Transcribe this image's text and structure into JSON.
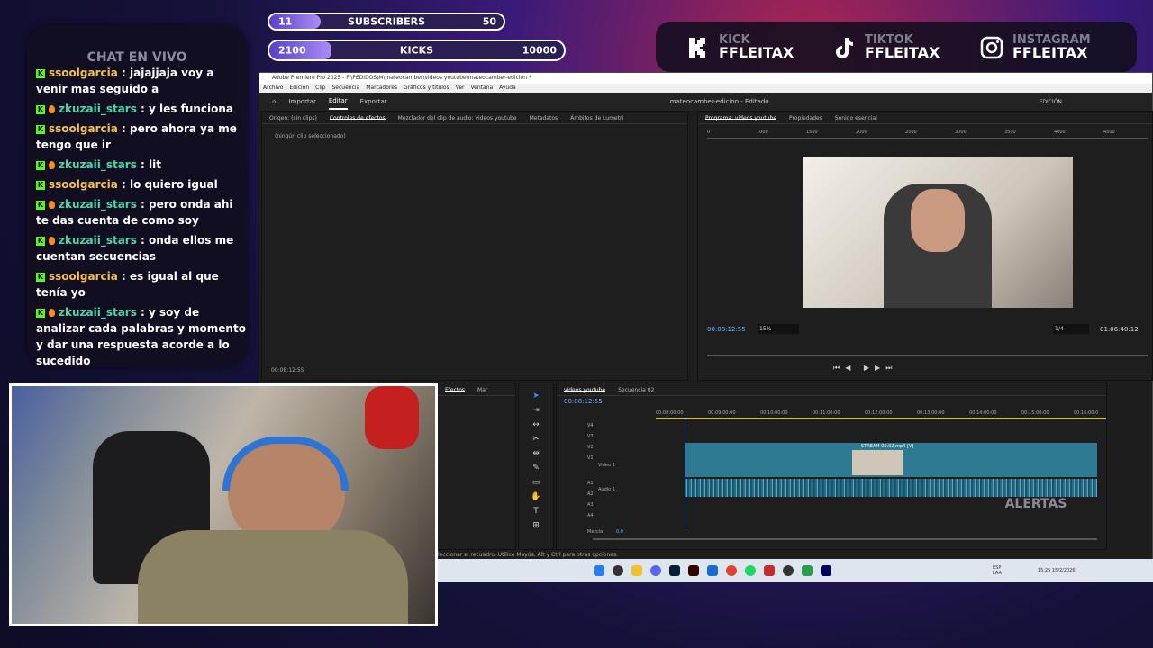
{
  "goals": [
    {
      "current": "11",
      "label": "SUBSCRIBERS",
      "goal": "50",
      "progress": 0.22
    },
    {
      "current": "2100",
      "label": "KICKS",
      "goal": "10000",
      "progress": 0.21
    }
  ],
  "chat": {
    "title": "CHAT EN VIVO",
    "messages": [
      {
        "user": "ssoolgarcia",
        "text": ": jajajjaja voy a venir mas seguido a",
        "badges": [
          "kick"
        ],
        "color": "u1"
      },
      {
        "user": "zkuzaii_stars",
        "text": ": y les funciona",
        "badges": [
          "kick",
          "fire"
        ],
        "color": "u2"
      },
      {
        "user": "ssoolgarcia",
        "text": ": pero ahora ya me tengo que ir",
        "badges": [
          "kick"
        ],
        "color": "u1"
      },
      {
        "user": "zkuzaii_stars",
        "text": ": lit",
        "badges": [
          "kick",
          "fire"
        ],
        "color": "u2"
      },
      {
        "user": "ssoolgarcia",
        "text": ": lo quiero igual",
        "badges": [
          "kick"
        ],
        "color": "u1"
      },
      {
        "user": "zkuzaii_stars",
        "text": ": pero onda ahi te das cuenta de como soy",
        "badges": [
          "kick",
          "fire"
        ],
        "color": "u2"
      },
      {
        "user": "zkuzaii_stars",
        "text": ": onda ellos me cuentan secuencias",
        "badges": [
          "kick",
          "fire"
        ],
        "color": "u2"
      },
      {
        "user": "ssoolgarcia",
        "text": ": es igual al que tenía yo",
        "badges": [
          "kick"
        ],
        "color": "u1"
      },
      {
        "user": "zkuzaii_stars",
        "text": ": y soy de analizar cada palabras y momento y dar una respuesta acorde a lo sucedido",
        "badges": [
          "kick",
          "fire"
        ],
        "color": "u2"
      }
    ]
  },
  "socials": [
    {
      "platform": "KICK",
      "handle": "FFLEITAX",
      "icon": "kick-icon"
    },
    {
      "platform": "TIKTOK",
      "handle": "FFLEITAX",
      "icon": "tiktok-icon"
    },
    {
      "platform": "INSTAGRAM",
      "handle": "FFLEITAX",
      "icon": "instagram-icon"
    }
  ],
  "premiere": {
    "title": "Adobe Premiere Pro 2025 - F:\\PEDIDOS\\M\\mateocamber\\videos youtube\\mateocamber-edicion *",
    "menu": [
      "Archivo",
      "Edición",
      "Clip",
      "Secuencia",
      "Marcadores",
      "Gráficos y títulos",
      "Ver",
      "Ventana",
      "Ayuda"
    ],
    "header_tabs": [
      "Importar",
      "Editar",
      "Exportar"
    ],
    "project_name": "mateocamber-edicion - Editado",
    "workspace": "EDICIÓN",
    "source_tabs": [
      "Origen: (sin clips)",
      "Controles de efectos",
      "Mezclador del clip de audio: videos youtube",
      "Metadatos",
      "Ámbitos de Lumetri"
    ],
    "no_clip": "(ningún clip seleccionado)",
    "source_time": "00:08:12:55",
    "program_tabs": [
      "Programa: videos youtube",
      "Propiedades",
      "Sonido esencial"
    ],
    "program_time": "00:08:12:55",
    "zoom": "15%",
    "quality": "1/4",
    "duration": "01:06:40:12",
    "ruler": [
      "0",
      "1000",
      "1500",
      "2000",
      "2500",
      "3000",
      "3500",
      "4000",
      "4500"
    ],
    "effects_tabs": [
      "Efectos",
      "Mar"
    ],
    "timeline_tabs": [
      "videos youtube",
      "Secuencia 02"
    ],
    "timeline_time": "00:08:12:55",
    "timecodes": [
      "00:08:00:00",
      "00:09:00:00",
      "00:10:00:00",
      "00:11:00:00",
      "00:12:00:00",
      "00:13:00:00",
      "00:14:00:00",
      "00:15:00:00",
      "00:16:00:0"
    ],
    "video_tracks": [
      "V4",
      "V3",
      "V2",
      "V1"
    ],
    "video1": "Video 1",
    "audio_tracks": [
      "A1",
      "A2",
      "A3",
      "A4"
    ],
    "audio1": "Audio 1",
    "mix_label": "Mezcla",
    "mix_value": "0,0",
    "clip_name": "STREAM 00:02.mp4 [V]",
    "status": "leccionar el recuadro. Utilice Mayús, Alt y Ctrl para otras opciones."
  },
  "taskbar": {
    "lang": "ESP\nLAA",
    "time": "15:25",
    "date": "15/2/2026"
  },
  "alerts": "ALERTAS"
}
